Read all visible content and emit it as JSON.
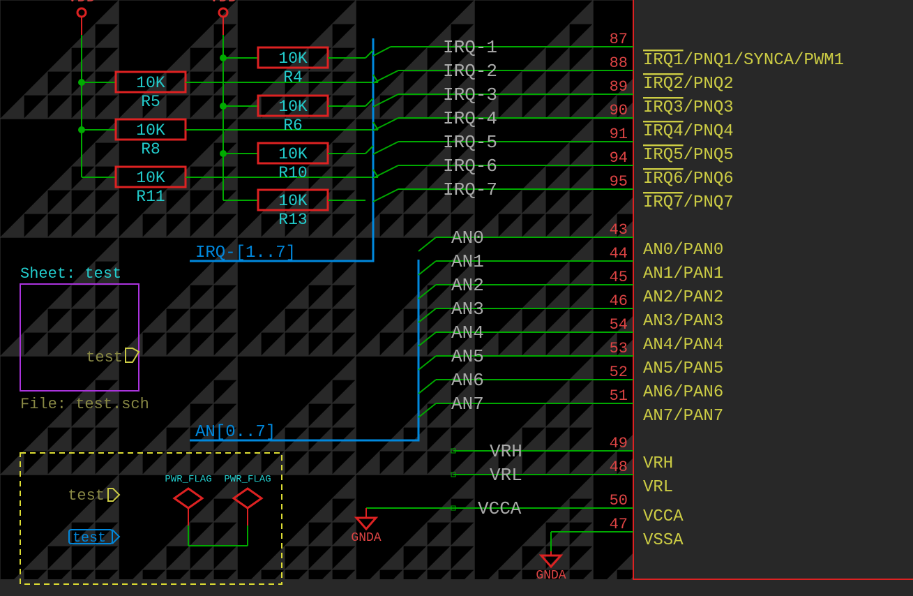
{
  "power": {
    "vdd1": "VDD",
    "vdd2": "VDD"
  },
  "resistors": [
    {
      "val": "10K",
      "ref": "R5"
    },
    {
      "val": "10K",
      "ref": "R8"
    },
    {
      "val": "10K",
      "ref": "R11"
    },
    {
      "val": "10K",
      "ref": "R4"
    },
    {
      "val": "10K",
      "ref": "R6"
    },
    {
      "val": "10K",
      "ref": "R10"
    },
    {
      "val": "10K",
      "ref": "R13"
    }
  ],
  "bus": {
    "irq": "IRQ-[1..7]",
    "an": "AN[0..7]"
  },
  "nets": {
    "irq": [
      "IRQ-1",
      "IRQ-2",
      "IRQ-3",
      "IRQ-4",
      "IRQ-5",
      "IRQ-6",
      "IRQ-7"
    ],
    "an": [
      "AN0",
      "AN1",
      "AN2",
      "AN3",
      "AN4",
      "AN5",
      "AN6",
      "AN7"
    ],
    "vrh": "VRH",
    "vrl": "VRL",
    "vcca": "VCCA"
  },
  "pins": {
    "irq": [
      "87",
      "88",
      "89",
      "90",
      "91",
      "94",
      "95"
    ],
    "an": [
      "43",
      "44",
      "45",
      "46",
      "54",
      "53",
      "52",
      "51"
    ],
    "vrh": "49",
    "vrl": "48",
    "vcca": "50",
    "vssa": "47"
  },
  "ic": {
    "irq": [
      "IRQ1/PNQ1/SYNCA/PWM1",
      "IRQ2/PNQ2",
      "IRQ3/PNQ3",
      "IRQ4/PNQ4",
      "IRQ5/PNQ5",
      "IRQ6/PNQ6",
      "IRQ7/PNQ7"
    ],
    "irq_over": [
      "IRQ1",
      "IRQ2",
      "IRQ3",
      "IRQ4",
      "IRQ5",
      "IRQ6",
      "IRQ7"
    ],
    "irq_rest": [
      "/PNQ1/SYNCA/PWM1",
      "/PNQ2",
      "/PNQ3",
      "/PNQ4",
      "/PNQ5",
      "/PNQ6",
      "/PNQ7"
    ],
    "an": [
      "AN0/PAN0",
      "AN1/PAN1",
      "AN2/PAN2",
      "AN3/PAN3",
      "AN4/PAN4",
      "AN5/PAN5",
      "AN6/PAN6",
      "AN7/PAN7"
    ],
    "vrh": "VRH",
    "vrl": "VRL",
    "vcca": "VCCA",
    "vssa": "VSSA"
  },
  "sheet": {
    "title": "Sheet: test",
    "port": "test",
    "file": "File: test.sch"
  },
  "flags": {
    "pf1": "PWR_FLAG",
    "pf2": "PWR_FLAG",
    "port_out": "test",
    "port_in": "test"
  },
  "gnd": {
    "a": "GNDA",
    "b": "GNDA"
  },
  "colors": {
    "bg": "#282828",
    "wire": "#00aa00",
    "comp": "#dd2222",
    "bus": "#0088dd",
    "label": "#22cccc",
    "ref": "#888844"
  }
}
